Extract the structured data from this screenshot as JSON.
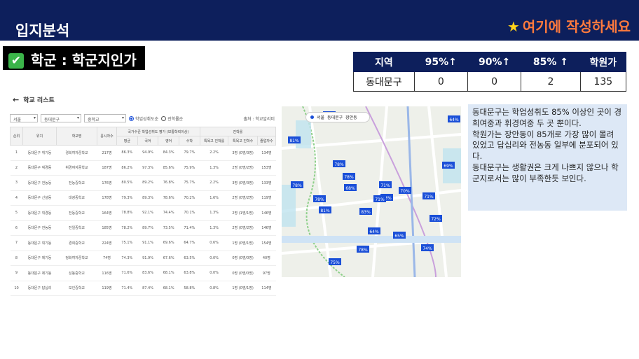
{
  "header": {
    "title": "입지분석",
    "note": "여기에 작성하세요"
  },
  "section": {
    "label": "학군 : 학군지인가"
  },
  "summary_table": {
    "headers": [
      "지역",
      "95%↑",
      "90%↑",
      "85% ↑",
      "학원가"
    ],
    "row": [
      "동대문구",
      "0",
      "0",
      "2",
      "135"
    ]
  },
  "school_panel": {
    "title": "학교 리스트",
    "filters": {
      "city": "서울",
      "district": "동대문구",
      "level": "중학교",
      "radio_1": "학업성취도순",
      "radio_2": "진학률순",
      "source": "출처 : 학교알리미"
    },
    "columns": [
      "순위",
      "위치",
      "학교명",
      "응시자수",
      "평균",
      "국어",
      "영어",
      "수학",
      "특목고 진학률",
      "특목고 진학수",
      "졸업자수"
    ],
    "group_headers": [
      "국가수준 학업성취도 평가 (보통학력이상)",
      "진학률"
    ],
    "rows": [
      [
        "1",
        "동대문구 휘기동",
        "경희여자중학교",
        "217명",
        "86.3%",
        "94.9%",
        "84.3%",
        "79.7%",
        "2.2%",
        "3명 (0명/3명)",
        "134명"
      ],
      [
        "2",
        "동대문구 휘경동",
        "휘경여자중학교",
        "187명",
        "86.2%",
        "97.3%",
        "85.6%",
        "75.9%",
        "1.3%",
        "2명 (0명/2명)",
        "153명"
      ],
      [
        "3",
        "동대문구 전농동",
        "전농중학교",
        "176명",
        "80.5%",
        "89.2%",
        "76.8%",
        "75.7%",
        "2.2%",
        "3명 (0명/3명)",
        "133명"
      ],
      [
        "4",
        "동대문구 신설동",
        "대광중학교",
        "178명",
        "79.3%",
        "89.3%",
        "78.6%",
        "70.2%",
        "1.6%",
        "2명 (0명/2명)",
        "119명"
      ],
      [
        "5",
        "동대문구 휘경동",
        "전동중학교",
        "164명",
        "78.8%",
        "92.1%",
        "74.4%",
        "70.1%",
        "1.3%",
        "2명 (1명/1명)",
        "146명"
      ],
      [
        "6",
        "동대문구 전농동",
        "전일중학교",
        "185명",
        "78.2%",
        "89.7%",
        "73.5%",
        "71.4%",
        "1.3%",
        "2명 (0명/2명)",
        "146명"
      ],
      [
        "7",
        "동대문구 휘기동",
        "경희중학교",
        "224명",
        "75.1%",
        "91.1%",
        "69.6%",
        "64.7%",
        "0.6%",
        "1명 (0명/1명)",
        "154명"
      ],
      [
        "8",
        "동대문구 제기동",
        "정화여자중학교",
        "74명",
        "74.3%",
        "91.9%",
        "67.6%",
        "63.5%",
        "0.0%",
        "0명 (0명/0명)",
        "40명"
      ],
      [
        "9",
        "동대문구 제기동",
        "성동중학교",
        "116명",
        "71.6%",
        "83.6%",
        "68.1%",
        "63.8%",
        "0.0%",
        "0명 (0명/0명)",
        "97명"
      ],
      [
        "10",
        "동대문구 답십리",
        "보인중학교",
        "119명",
        "71.4%",
        "87.4%",
        "68.1%",
        "58.8%",
        "0.8%",
        "1명 (0명/1명)",
        "114명"
      ]
    ]
  },
  "map": {
    "region": "서울",
    "district": "동대문구",
    "dong": "장안동",
    "markers": [
      "81%",
      "65%",
      "64%",
      "78%",
      "78%",
      "78%",
      "78%",
      "71%",
      "81%",
      "83%",
      "73%",
      "69%",
      "68%",
      "70%",
      "71%",
      "71%",
      "64%",
      "65%",
      "78%",
      "74%",
      "72%",
      "75%"
    ]
  },
  "description": "동대문구는 학업성취도 85% 이상인 곳이 경희여중과 휘경여중  두 곳 뿐이다.\n학원가는 장안동이 85개로 가장 많이 몰려 있었고 답십리와 전농동 일부에 분포되어 있다.\n동대문구는 생활권은 크게 나쁘지 않으나 학군지로서는 많이 부족한듯 보인다.",
  "colors": {
    "navy": "#0d1f5c",
    "accent": "#ff7a3d",
    "star": "#ffd21a",
    "marker": "#1a4fd8",
    "desc_bg": "#dde8f6"
  }
}
